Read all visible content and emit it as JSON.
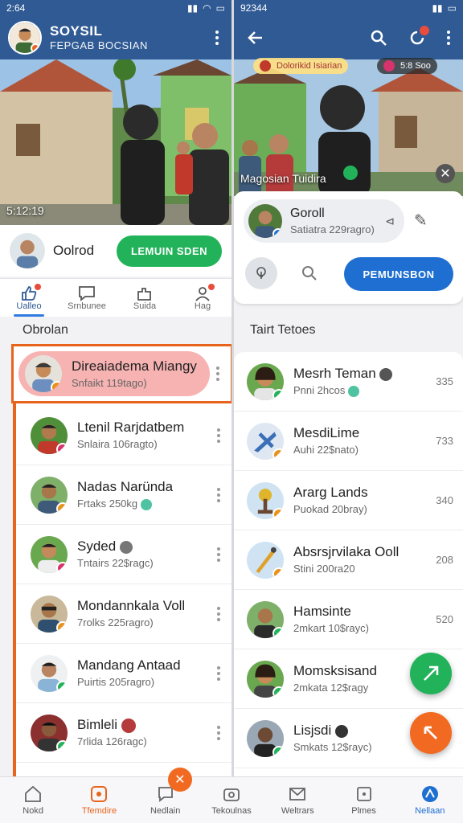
{
  "left": {
    "status": {
      "time": "2:64"
    },
    "header": {
      "title": "SOYSIL",
      "subtitle": "FEPGAB BOCSIAN"
    },
    "scene": {
      "caption": "5:12:19"
    },
    "action": {
      "name": "Oolrod",
      "button": "LEMUIN SDEN"
    },
    "tabs": [
      {
        "label": "Ualleo",
        "icon": "thumbs-up-icon"
      },
      {
        "label": "Srnbunee",
        "icon": "chat-square-icon"
      },
      {
        "label": "Suida",
        "icon": "puzzle-icon"
      },
      {
        "label": "Hag",
        "icon": "person-icon"
      }
    ],
    "section": "Obrolan",
    "chats": [
      {
        "name": "Direaiadema Miangy",
        "sub": "Snfaikt 119tago)",
        "dot": "#e8921d"
      },
      {
        "name": "Ltenil Rarjdatbem",
        "sub": "Snlaira 106ragto)",
        "dot": "#d6336c"
      },
      {
        "name": "Nadas Naründa",
        "sub": "Frtaks 250kg",
        "dot": "#e8921d"
      },
      {
        "name": "Syded",
        "sub": "Tntairs 22$ragc)",
        "dot": "#d6336c"
      },
      {
        "name": "Mondannkala Voll",
        "sub": "7rolks 225ragro)",
        "dot": "#e8921d"
      },
      {
        "name": "Mandang Antaad",
        "sub": "Puirtis 205ragro)",
        "dot": "#22b35a"
      },
      {
        "name": "Bimleli",
        "sub": "7rlida 126ragc)",
        "dot": "#22b35a"
      }
    ]
  },
  "right": {
    "status": {
      "time": "92344"
    },
    "top_pills": [
      "Dolorikid Isiarian",
      "5:8 Soo"
    ],
    "scene": {
      "caption": "Magosian Tuidira"
    },
    "card": {
      "name": "Goroll",
      "sub": "Satiatra 229ragro)",
      "button": "PEMUNSBON"
    },
    "section": "Tairt Tetoes",
    "chats": [
      {
        "name": "Mesrh Teman",
        "sub": "Pnni 2hcos",
        "count": "335",
        "dot": "#22b35a"
      },
      {
        "name": "MesdiLime",
        "sub": "Auhi 22$nato)",
        "count": "733",
        "dot": "#e8921d"
      },
      {
        "name": "Ararg Lands",
        "sub": "Puokad 20bray)",
        "count": "340",
        "dot": "#e8921d"
      },
      {
        "name": "Absrsjrvilaka Ooll",
        "sub": "Stini 200ra20",
        "count": "208",
        "dot": "#e8921d"
      },
      {
        "name": "Hamsinte",
        "sub": "2mkart 10$rayc)",
        "count": "520",
        "dot": "#22b35a"
      },
      {
        "name": "Momsksisand",
        "sub": "2mkata 12$ragy",
        "count": "",
        "dot": "#22b35a"
      },
      {
        "name": "Lisjsdi",
        "sub": "Smkats 12$rayc)",
        "count": "",
        "dot": "#22b35a"
      }
    ]
  },
  "bottom_nav": [
    {
      "label": "Nokd",
      "icon": "home-icon"
    },
    {
      "label": "Tfemdire",
      "icon": "camera-square-icon"
    },
    {
      "label": "Nedlain",
      "icon": "chat-bubble-icon"
    },
    {
      "label": "Tekoulnas",
      "icon": "camera-icon"
    },
    {
      "label": "Weltrars",
      "icon": "mail-icon"
    },
    {
      "label": "Plmes",
      "icon": "square-icon"
    },
    {
      "label": "Nellaan",
      "icon": "compass-icon"
    }
  ],
  "colors": {
    "primary": "#2f5a94",
    "accent_orange": "#e8641d",
    "green": "#22b35a",
    "blue": "#1e6fd1"
  }
}
